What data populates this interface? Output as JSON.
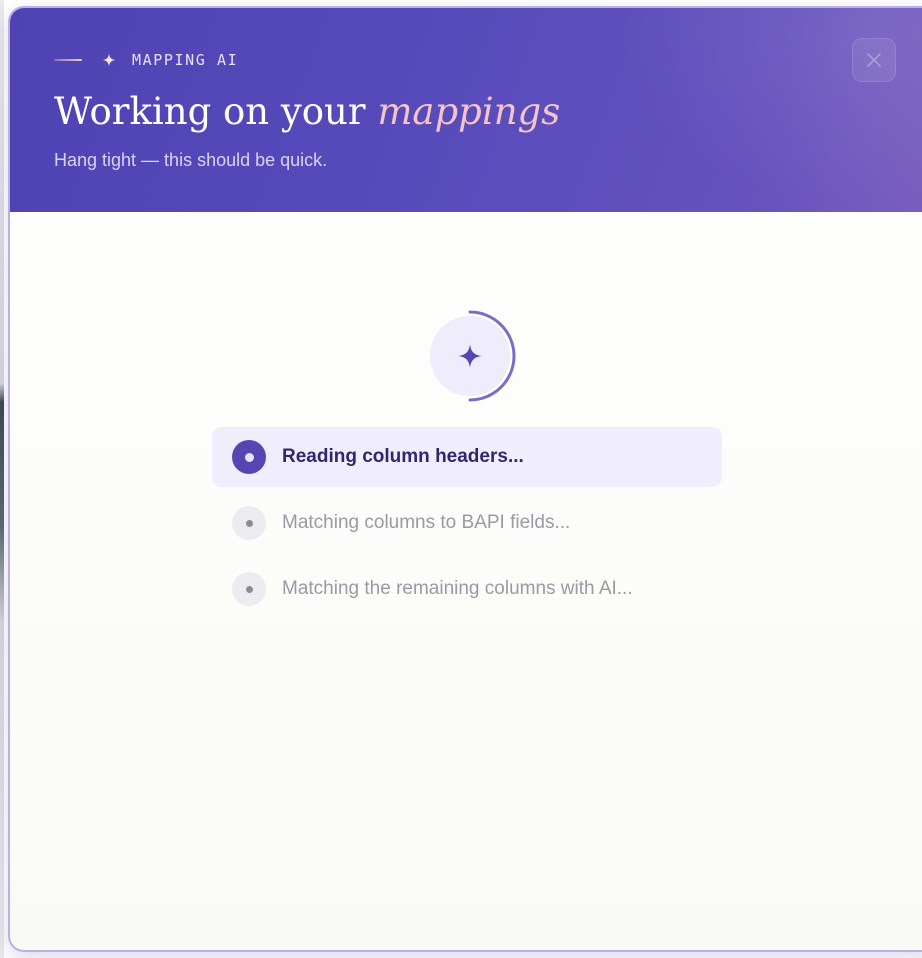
{
  "header": {
    "eyebrow": "MAPPING AI",
    "title_prefix": "Working on your ",
    "title_accent": "mappings",
    "subtitle": "Hang tight — this should be quick.",
    "close_icon": "close-icon",
    "spark_icon": "sparkle-icon"
  },
  "loader": {
    "icon": "sparkle-icon",
    "steps": [
      {
        "label": "Reading column headers...",
        "state": "active"
      },
      {
        "label": "Matching columns to BAPI fields...",
        "state": "pending"
      },
      {
        "label": "Matching the remaining columns with AI...",
        "state": "pending"
      }
    ]
  },
  "colors": {
    "header_gradient_start": "#4f43b4",
    "header_gradient_end": "#7a5fbf",
    "accent_text": "#f5c4c9",
    "active_step_bg": "#f0eefc",
    "active_dot": "#5546b3",
    "modal_border": "#b9b0e6"
  }
}
